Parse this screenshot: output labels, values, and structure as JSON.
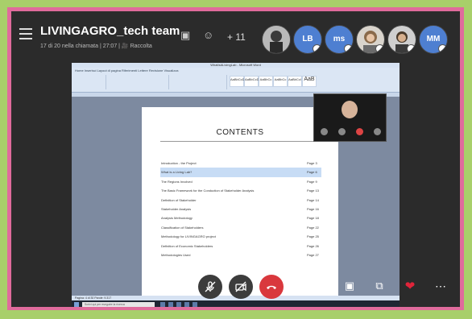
{
  "meeting": {
    "title": "LIVINGAGRO_tech team",
    "subtitle": "17 di 20 nella chiamata | 27:07 | 🎥 Raccolta",
    "more_participants": "+ 11"
  },
  "participants": [
    {
      "type": "photo",
      "name": "participant-1"
    },
    {
      "type": "initials",
      "label": "LB",
      "color": "#4e7fd1"
    },
    {
      "type": "initials",
      "label": "ms",
      "color": "#4e7fd1"
    },
    {
      "type": "photo",
      "name": "participant-4"
    },
    {
      "type": "photo",
      "name": "participant-5"
    },
    {
      "type": "initials",
      "label": "MM",
      "color": "#4e7fd1"
    }
  ],
  "document": {
    "window_title": "WhatIsALivingLab - Microsoft Word",
    "ribbon_tabs": "Home   Inserisci   Layout di pagina   Riferimenti   Lettere   Revisione   Visualizza",
    "styles": [
      "AaBbCcDc",
      "AaBbCcDc",
      "AaBbCc",
      "AaBbCc",
      "AaBbCcI",
      "AaB"
    ],
    "heading": "CONTENTS",
    "toc": [
      {
        "label": "Introduction - the Project",
        "page": "Page 3",
        "highlight": false
      },
      {
        "label": "What is a Living Lab?",
        "page": "Page 6",
        "highlight": true
      },
      {
        "label": "The Regions Involved",
        "page": "Page 9",
        "highlight": false
      },
      {
        "label": "The Basic Framework for the Conduction of Stakeholder Analysis",
        "page": "Page 13",
        "highlight": false
      },
      {
        "label": "Definition of Stakeholder",
        "page": "Page 14",
        "highlight": false
      },
      {
        "label": "Stakeholder Analysis",
        "page": "Page 16",
        "highlight": false
      },
      {
        "label": "Analysis Methodology",
        "page": "Page 18",
        "highlight": false
      },
      {
        "label": "Classification of Stakeholders",
        "page": "Page 22",
        "highlight": false
      },
      {
        "label": "Methodology for LIVINGAGRO project",
        "page": "Page 25",
        "highlight": false
      },
      {
        "label": "Definition of Economic Stakeholders",
        "page": "Page 26",
        "highlight": false
      },
      {
        "label": "Methodologies Used",
        "page": "Page 27",
        "highlight": false
      }
    ],
    "status_bar": "Pagina: 4 di 30   Parole: 9.317",
    "taskbar_search": "Scrivi qui per eseguire la ricerca"
  },
  "colors": {
    "outer_frame": "#a8cf6a",
    "inner_frame": "#e06b9c",
    "end_call": "#d9383d",
    "heart": "#e0243a"
  }
}
